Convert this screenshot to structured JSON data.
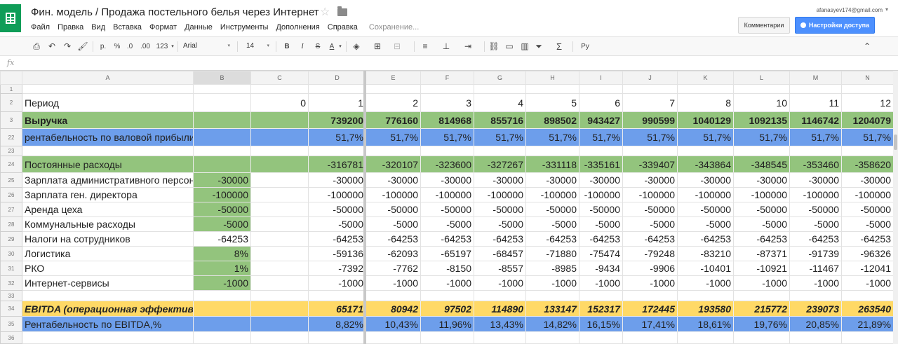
{
  "window": {
    "title": "Фин. модель / Продажа постельного белья через Интернет",
    "account": "afanasyev174@gmail.com"
  },
  "menu": {
    "items": [
      "Файл",
      "Правка",
      "Вид",
      "Вставка",
      "Формат",
      "Данные",
      "Инструменты",
      "Дополнения",
      "Справка"
    ],
    "status": "Сохранение..."
  },
  "buttons": {
    "comments": "Комментарии",
    "share": "Настройки доступа"
  },
  "toolbar": {
    "currency": "р.",
    "percent": "%",
    "dec_decrease": ".0",
    "dec_increase": ".00",
    "more_formats": "123",
    "font": "Arial",
    "size": "14",
    "bold": "B",
    "italic": "I",
    "strike": "S",
    "text_color": "A",
    "sum": "Σ",
    "input_tools": "Ру"
  },
  "formula_bar": {
    "fx": "fx",
    "value": ""
  },
  "grid": {
    "columns": [
      "A",
      "B",
      "C",
      "D",
      "E",
      "F",
      "G",
      "H",
      "I",
      "J",
      "K",
      "L",
      "M",
      "N"
    ],
    "selected_column": "B",
    "rows": [
      {
        "n": "1",
        "cells": [
          "",
          "",
          "",
          "",
          "",
          "",
          "",
          "",
          "",
          "",
          "",
          "",
          "",
          ""
        ]
      },
      {
        "n": "2",
        "cells": [
          "Период",
          "",
          "0",
          "1",
          "2",
          "3",
          "4",
          "5",
          "6",
          "7",
          "8",
          "10",
          "11",
          "12"
        ]
      },
      {
        "n": "3",
        "cells": [
          "Выручка",
          "",
          "",
          "739200",
          "776160",
          "814968",
          "855716",
          "898502",
          "943427",
          "990599",
          "1040129",
          "1092135",
          "1146742",
          "1204079"
        ]
      },
      {
        "n": "22",
        "cells": [
          "рентабельность по валовой прибыли",
          "",
          "",
          "51,7%",
          "51,7%",
          "51,7%",
          "51,7%",
          "51,7%",
          "51,7%",
          "51,7%",
          "51,7%",
          "51,7%",
          "51,7%",
          "51,7%"
        ]
      },
      {
        "n": "23",
        "cells": [
          "",
          "",
          "",
          "",
          "",
          "",
          "",
          "",
          "",
          "",
          "",
          "",
          "",
          ""
        ]
      },
      {
        "n": "24",
        "cells": [
          "Постоянные расходы",
          "",
          "",
          "-316781",
          "-320107",
          "-323600",
          "-327267",
          "-331118",
          "-335161",
          "-339407",
          "-343864",
          "-348545",
          "-353460",
          "-358620"
        ]
      },
      {
        "n": "25",
        "cells": [
          "Зарплата административного персонала",
          "-30000",
          "",
          "-30000",
          "-30000",
          "-30000",
          "-30000",
          "-30000",
          "-30000",
          "-30000",
          "-30000",
          "-30000",
          "-30000",
          "-30000"
        ]
      },
      {
        "n": "26",
        "cells": [
          "Зарплата ген. директора",
          "-100000",
          "",
          "-100000",
          "-100000",
          "-100000",
          "-100000",
          "-100000",
          "-100000",
          "-100000",
          "-100000",
          "-100000",
          "-100000",
          "-100000"
        ]
      },
      {
        "n": "27",
        "cells": [
          "Аренда цеха",
          "-50000",
          "",
          "-50000",
          "-50000",
          "-50000",
          "-50000",
          "-50000",
          "-50000",
          "-50000",
          "-50000",
          "-50000",
          "-50000",
          "-50000"
        ]
      },
      {
        "n": "28",
        "cells": [
          "Коммунальные расходы",
          "-5000",
          "",
          "-5000",
          "-5000",
          "-5000",
          "-5000",
          "-5000",
          "-5000",
          "-5000",
          "-5000",
          "-5000",
          "-5000",
          "-5000"
        ]
      },
      {
        "n": "29",
        "cells": [
          "Налоги на сотрудников",
          "-64253",
          "",
          "-64253",
          "-64253",
          "-64253",
          "-64253",
          "-64253",
          "-64253",
          "-64253",
          "-64253",
          "-64253",
          "-64253",
          "-64253"
        ]
      },
      {
        "n": "30",
        "cells": [
          "Логистика",
          "8%",
          "",
          "-59136",
          "-62093",
          "-65197",
          "-68457",
          "-71880",
          "-75474",
          "-79248",
          "-83210",
          "-87371",
          "-91739",
          "-96326"
        ]
      },
      {
        "n": "31",
        "cells": [
          "РКО",
          "1%",
          "",
          "-7392",
          "-7762",
          "-8150",
          "-8557",
          "-8985",
          "-9434",
          "-9906",
          "-10401",
          "-10921",
          "-11467",
          "-12041"
        ]
      },
      {
        "n": "32",
        "cells": [
          "Интернет-сервисы",
          "-1000",
          "",
          "-1000",
          "-1000",
          "-1000",
          "-1000",
          "-1000",
          "-1000",
          "-1000",
          "-1000",
          "-1000",
          "-1000",
          "-1000"
        ]
      },
      {
        "n": "33",
        "cells": [
          "",
          "",
          "",
          "",
          "",
          "",
          "",
          "",
          "",
          "",
          "",
          "",
          "",
          ""
        ]
      },
      {
        "n": "34",
        "cells": [
          "EBITDA (операционная эффективность)",
          "",
          "",
          "65171",
          "80942",
          "97502",
          "114890",
          "133147",
          "152317",
          "172445",
          "193580",
          "215772",
          "239073",
          "263540"
        ]
      },
      {
        "n": "35",
        "cells": [
          "Рентабельность по EBITDA,%",
          "",
          "",
          "8,82%",
          "10,43%",
          "11,96%",
          "13,43%",
          "14,82%",
          "16,15%",
          "17,41%",
          "18,61%",
          "19,76%",
          "20,85%",
          "21,89%"
        ]
      },
      {
        "n": "36",
        "cells": [
          "",
          "",
          "",
          "",
          "",
          "",
          "",
          "",
          "",
          "",
          "",
          "",
          "",
          ""
        ]
      }
    ]
  },
  "colors": {
    "green_fill": "#93c47d",
    "blue_fill": "#6d9eeb",
    "yellow_fill": "#ffd966",
    "share_button": "#4d90fe",
    "app_icon": "#0f9d58"
  }
}
